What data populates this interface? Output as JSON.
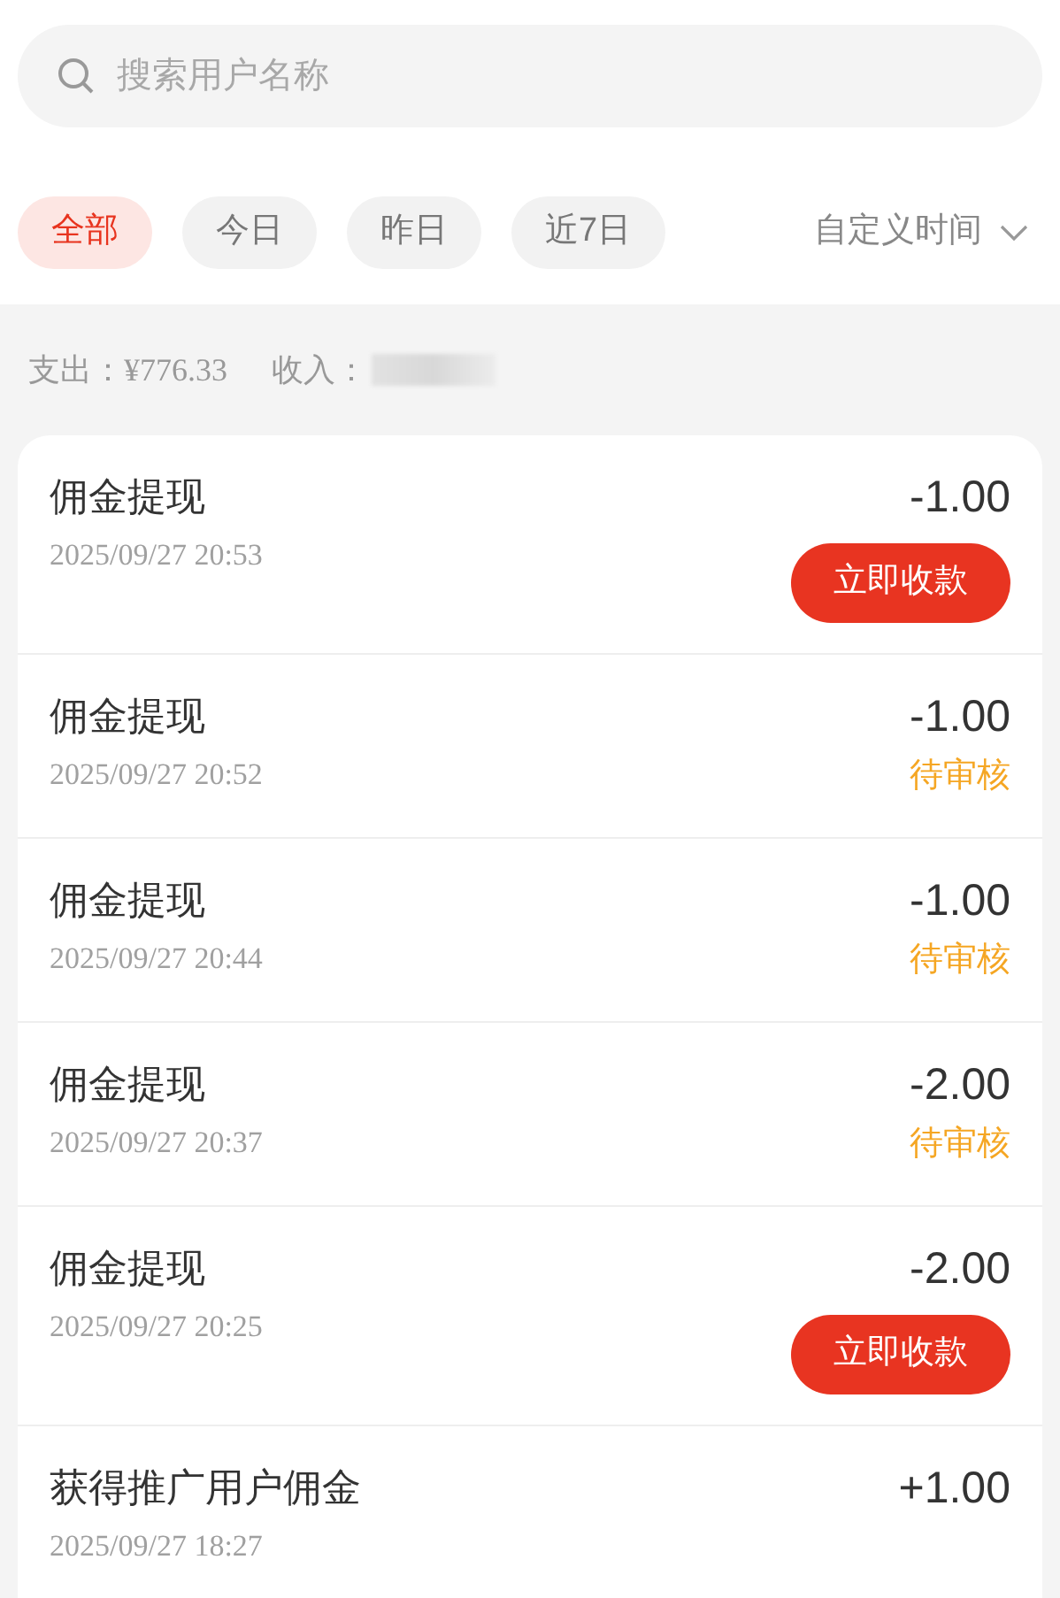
{
  "search": {
    "placeholder": "搜索用户名称"
  },
  "filters": [
    {
      "label": "全部",
      "selected": true
    },
    {
      "label": "今日",
      "selected": false
    },
    {
      "label": "昨日",
      "selected": false
    },
    {
      "label": "近7日",
      "selected": false
    }
  ],
  "custom_time": {
    "label": "自定义时间"
  },
  "summary": {
    "expense_label": "支出：",
    "expense": "¥776.33",
    "income_label": "收入："
  },
  "records": [
    {
      "title": "佣金提现",
      "time": "2025/09/27 20:53",
      "amount": "-1.00",
      "kind": "action",
      "status": "立即收款"
    },
    {
      "title": "佣金提现",
      "time": "2025/09/27 20:52",
      "amount": "-1.00",
      "kind": "pending",
      "status": "待审核"
    },
    {
      "title": "佣金提现",
      "time": "2025/09/27 20:44",
      "amount": "-1.00",
      "kind": "pending",
      "status": "待审核"
    },
    {
      "title": "佣金提现",
      "time": "2025/09/27 20:37",
      "amount": "-2.00",
      "kind": "pending",
      "status": "待审核"
    },
    {
      "title": "佣金提现",
      "time": "2025/09/27 20:25",
      "amount": "-2.00",
      "kind": "action",
      "status": "立即收款"
    },
    {
      "title": "获得推广用户佣金",
      "time": "2025/09/27 18:27",
      "amount": "+1.00",
      "kind": "none"
    }
  ]
}
